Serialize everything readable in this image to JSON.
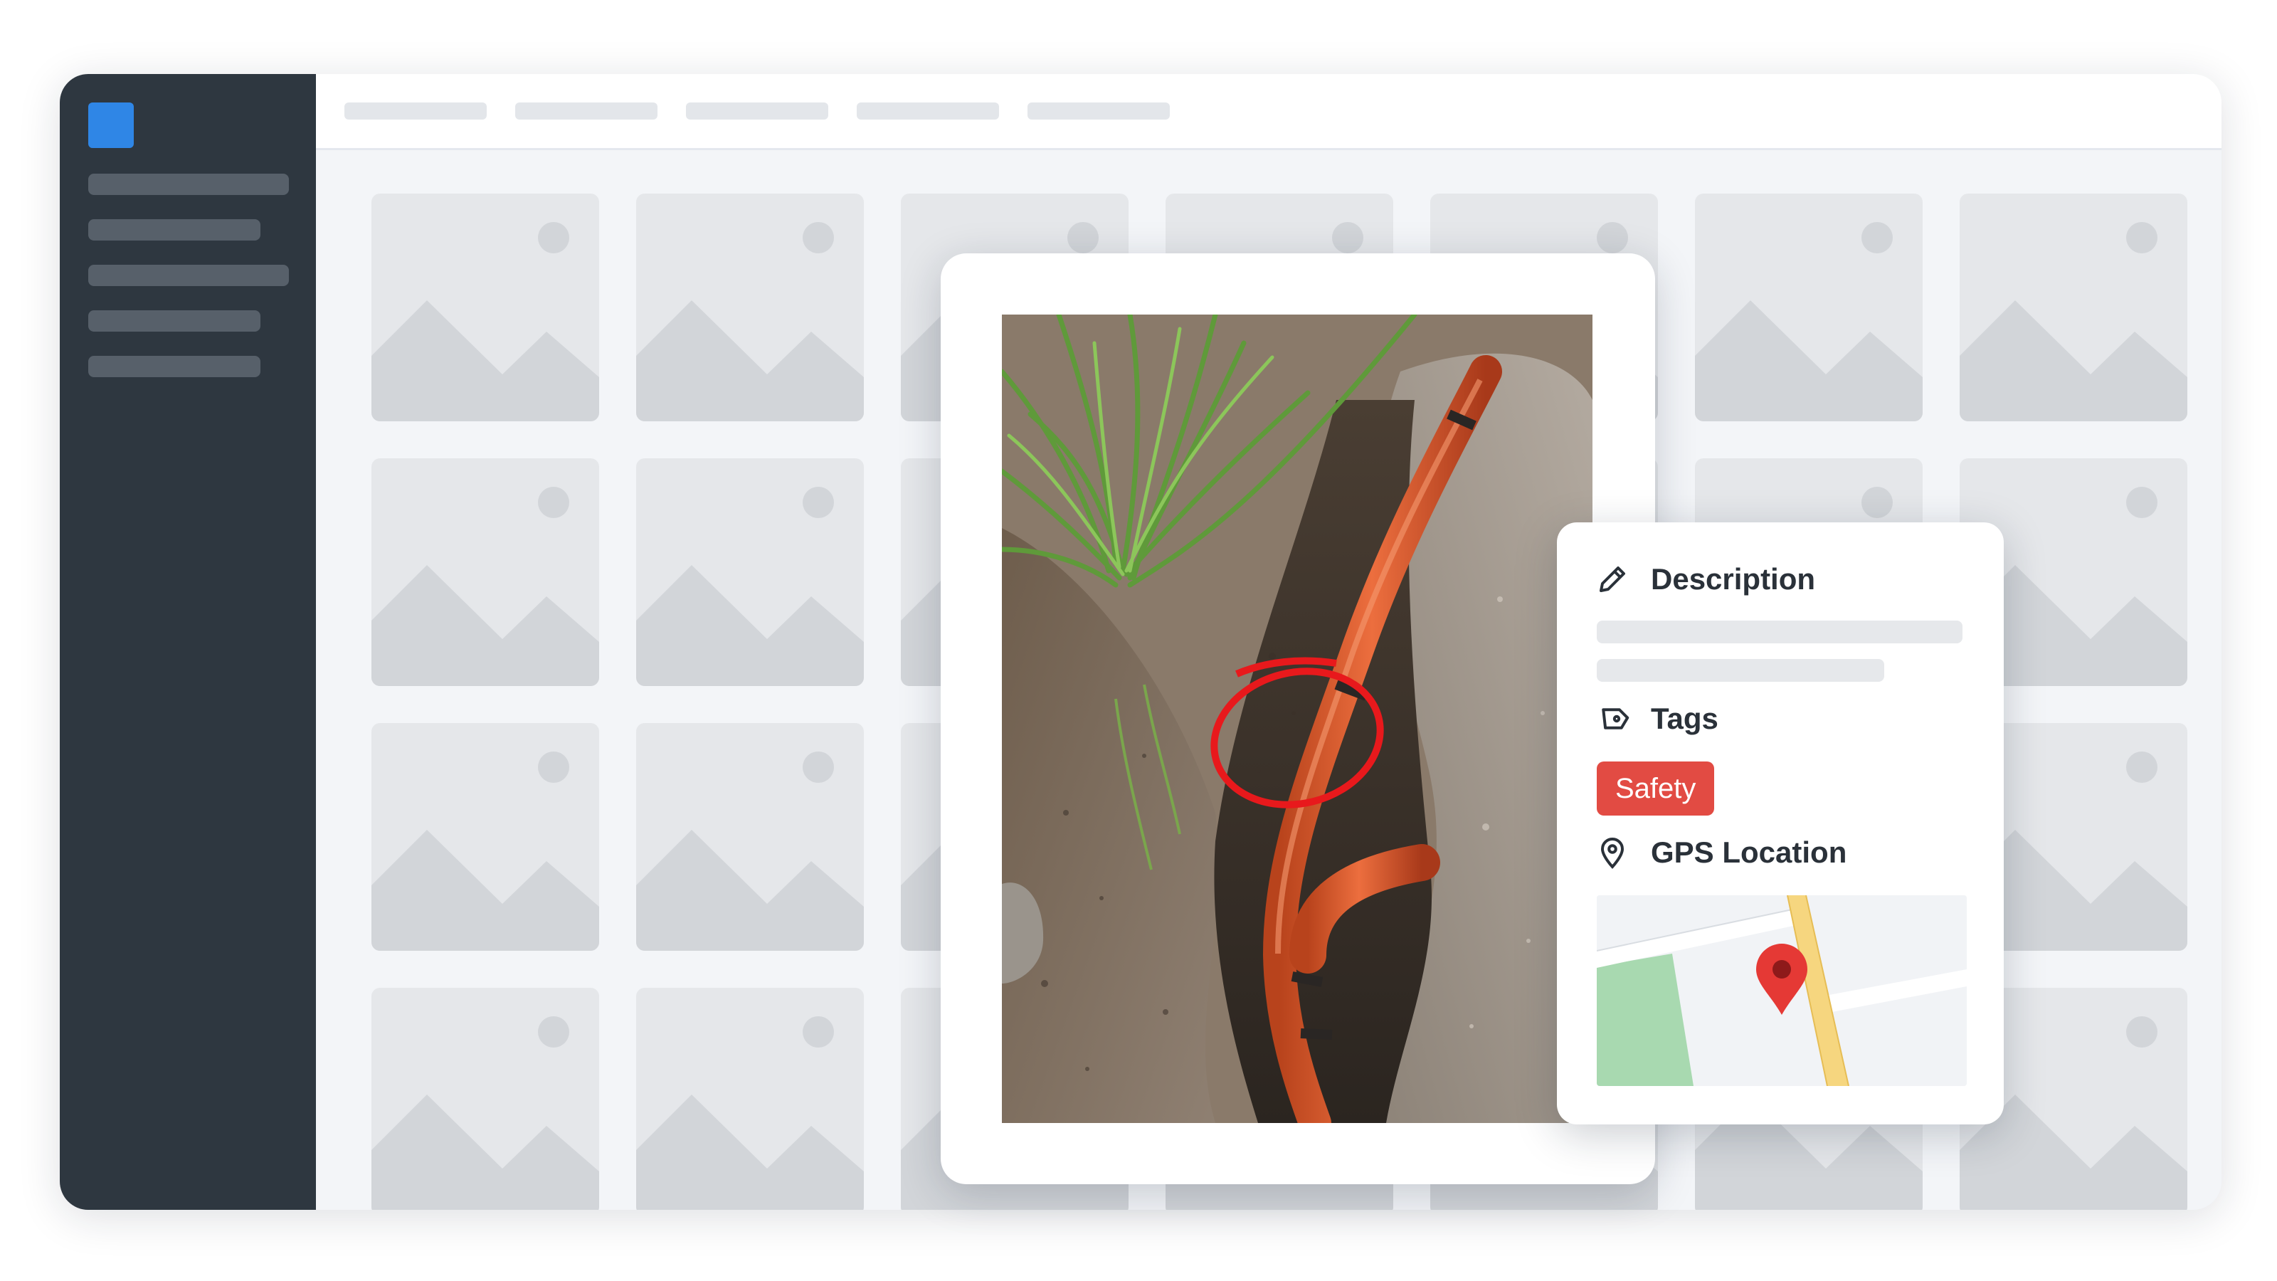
{
  "app": {
    "brand_color": "#2f86e6",
    "logo_icon": "app-logo-square",
    "sidebar_item_count": 5,
    "top_nav_item_count": 5
  },
  "gallery": {
    "placeholder_icon": "image-placeholder-icon",
    "tile_color": "#e5e7ea"
  },
  "photo": {
    "subject": "orange conduit in trench",
    "annotation": "red circle",
    "annotation_color": "#e8191c"
  },
  "details": {
    "description": {
      "icon": "pencil-icon",
      "label": "Description"
    },
    "tags": {
      "icon": "tag-icon",
      "label": "Tags",
      "items": [
        {
          "label": "Safety",
          "color": "#e24b43"
        }
      ]
    },
    "gps": {
      "icon": "location-pin-icon",
      "label": "GPS Location",
      "map_pin_color": "#e53935"
    }
  }
}
